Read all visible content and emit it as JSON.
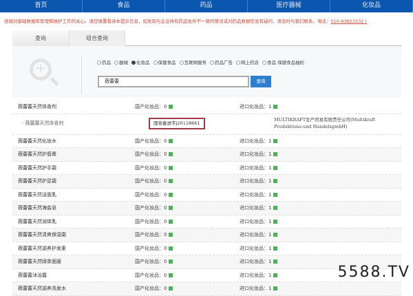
{
  "nav": [
    "首页",
    "食品",
    "药品",
    "医疗器械",
    "化妆品"
  ],
  "notice": {
    "text": "感谢对基础数据库管理和维护工作的关心。请您慎重看待本提示信息，如发现与企业持有药品批件不一致的情况或对药品数据信息有疑问，请及时与我们联系。电话：",
    "phone": "010-63923332 ("
  },
  "tabs": [
    "查询",
    "组合查询"
  ],
  "radios": [
    {
      "label": "药品",
      "checked": false
    },
    {
      "label": "器械",
      "checked": false
    },
    {
      "label": "化妆品",
      "checked": true
    },
    {
      "label": "保健食品",
      "checked": false
    },
    {
      "label": "互联网服务",
      "checked": false
    },
    {
      "label": "药品广告",
      "checked": false
    },
    {
      "label": "网上药店",
      "checked": false
    },
    {
      "label": "食品 保健食品抽检",
      "checked": false
    }
  ],
  "search": {
    "value": "薇蕾蕾",
    "button": "查询"
  },
  "first": {
    "name": "薇蕾蕾天然体香剂",
    "domestic": "国产化妆品：0",
    "imported": "进口化妆品：1",
    "sub_name": "薇蕾蕾天然体香剂",
    "reg": "国妆备进字J20118661",
    "company": "MULTIKRAFT生产贸易有限责任公司(Multikraft Produktions-und HandelsgmbH)"
  },
  "rows": [
    {
      "name": "薇蕾蕾天然化妆水",
      "domestic": "国产化妆品：0",
      "imported": "进口化妆品：1"
    },
    {
      "name": "薇蕾蕾天然护唇膏",
      "domestic": "国产化妆品：0",
      "imported": "进口化妆品：1"
    },
    {
      "name": "薇蕾蕾天然护手霜",
      "domestic": "国产化妆品：0",
      "imported": "进口化妆品：1"
    },
    {
      "name": "薇蕾蕾天然护足霜",
      "domestic": "国产化妆品：0",
      "imported": "进口化妆品：1"
    },
    {
      "name": "薇蕾蕾天然洁面乳",
      "domestic": "国产化妆品：0",
      "imported": "进口化妆品：1"
    },
    {
      "name": "薇蕾蕾天然海盐皂",
      "domestic": "国产化妆品：0",
      "imported": "进口化妆品：1"
    },
    {
      "name": "薇蕾蕾天然润体乳",
      "domestic": "国产化妆品：0",
      "imported": "进口化妆品：1"
    },
    {
      "name": "薇蕾蕾天然清爽保湿霜",
      "domestic": "国产化妆品：0",
      "imported": "进口化妆品：1"
    },
    {
      "name": "薇蕾蕾天然滋养护发素",
      "domestic": "国产化妆品：0",
      "imported": "进口化妆品：1"
    },
    {
      "name": "薇蕾蕾天然绿茶面膜",
      "domestic": "国产化妆品：0",
      "imported": "进口化妆品：1"
    },
    {
      "name": "薇蕾蕾沐浴露",
      "domestic": "国产化妆品：0",
      "imported": "进口化妆品：1"
    },
    {
      "name": "薇蕾蕾天然滋养洗发水",
      "domestic": "国产化妆品：0",
      "imported": "进口化妆品：1"
    }
  ],
  "watermark": "5588.TV"
}
